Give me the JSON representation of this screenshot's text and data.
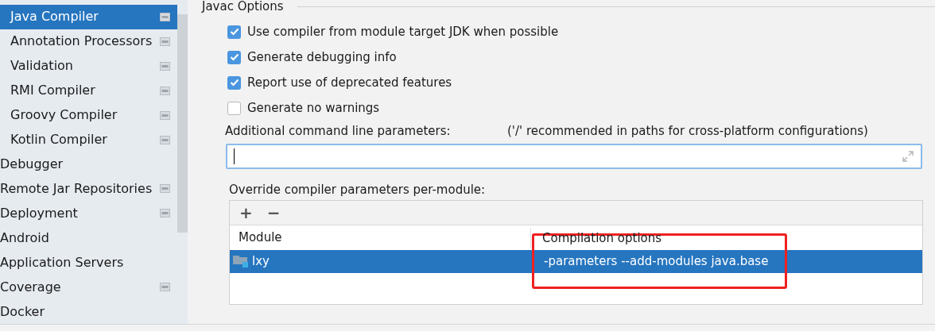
{
  "sidebar": {
    "items": [
      {
        "label": "Java Compiler",
        "kind": "sub",
        "selected": true,
        "project_icon": true
      },
      {
        "label": "Annotation Processors",
        "kind": "sub",
        "selected": false,
        "project_icon": true
      },
      {
        "label": "Validation",
        "kind": "sub",
        "selected": false,
        "project_icon": true
      },
      {
        "label": "RMI Compiler",
        "kind": "sub",
        "selected": false,
        "project_icon": true
      },
      {
        "label": "Groovy Compiler",
        "kind": "sub",
        "selected": false,
        "project_icon": true
      },
      {
        "label": "Kotlin Compiler",
        "kind": "sub",
        "selected": false,
        "project_icon": true
      },
      {
        "label": "Debugger",
        "kind": "top",
        "selected": false,
        "project_icon": false
      },
      {
        "label": "Remote Jar Repositories",
        "kind": "top",
        "selected": false,
        "project_icon": true
      },
      {
        "label": "Deployment",
        "kind": "top",
        "selected": false,
        "project_icon": true
      },
      {
        "label": "Android",
        "kind": "top",
        "selected": false,
        "project_icon": false
      },
      {
        "label": "Application Servers",
        "kind": "top",
        "selected": false,
        "project_icon": false
      },
      {
        "label": "Coverage",
        "kind": "top",
        "selected": false,
        "project_icon": true
      },
      {
        "label": "Docker",
        "kind": "top",
        "selected": false,
        "project_icon": false
      }
    ]
  },
  "section_title": "Javac Options",
  "options": [
    {
      "label": "Use compiler from module target JDK when possible",
      "checked": true
    },
    {
      "label": "Generate debugging info",
      "checked": true
    },
    {
      "label": "Report use of deprecated features",
      "checked": true
    },
    {
      "label": "Generate no warnings",
      "checked": false
    }
  ],
  "additional_parameters": {
    "label": "Additional command line parameters:",
    "hint": "('/' recommended in paths for cross-platform configurations)"
  },
  "override": {
    "label": "Override compiler parameters per-module:",
    "toolbar": [
      "+",
      "−"
    ],
    "columns": [
      "Module",
      "Compilation options"
    ],
    "rows": [
      {
        "module": "lxy",
        "options": "-parameters --add-modules java.base",
        "selected": true
      }
    ]
  }
}
